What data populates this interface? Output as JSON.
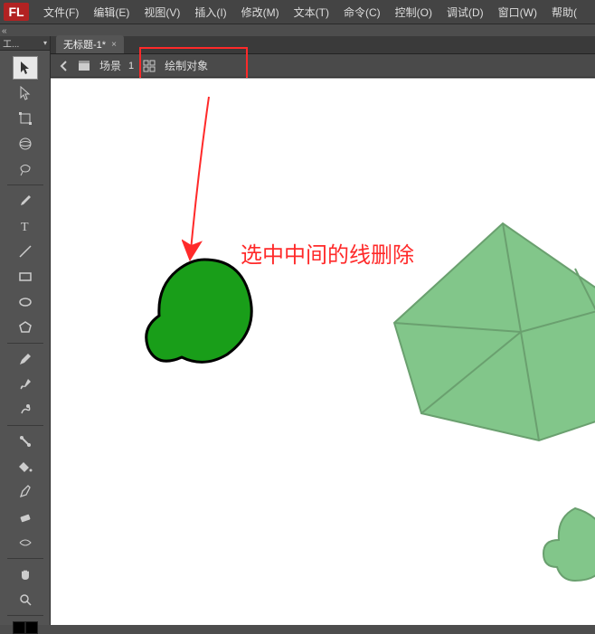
{
  "app": {
    "logo": "FL"
  },
  "menu": {
    "file": "文件(F)",
    "edit": "编辑(E)",
    "view": "视图(V)",
    "insert": "插入(I)",
    "modify": "修改(M)",
    "text": "文本(T)",
    "command": "命令(C)",
    "control": "控制(O)",
    "debug": "调试(D)",
    "window": "窗口(W)",
    "help": "帮助("
  },
  "tool_panel": {
    "title": "工..."
  },
  "document": {
    "tab_label": "无标题-1*",
    "scene_label": "场景",
    "scene_number": "1",
    "draw_object_label": "绘制对象"
  },
  "annotation": {
    "text": "选中中间的线删除"
  },
  "colors": {
    "accent_red": "#ff2a2a",
    "shape_green": "#199e19",
    "shape_light_green": "#82c68a",
    "stroke_black": "#000000"
  }
}
